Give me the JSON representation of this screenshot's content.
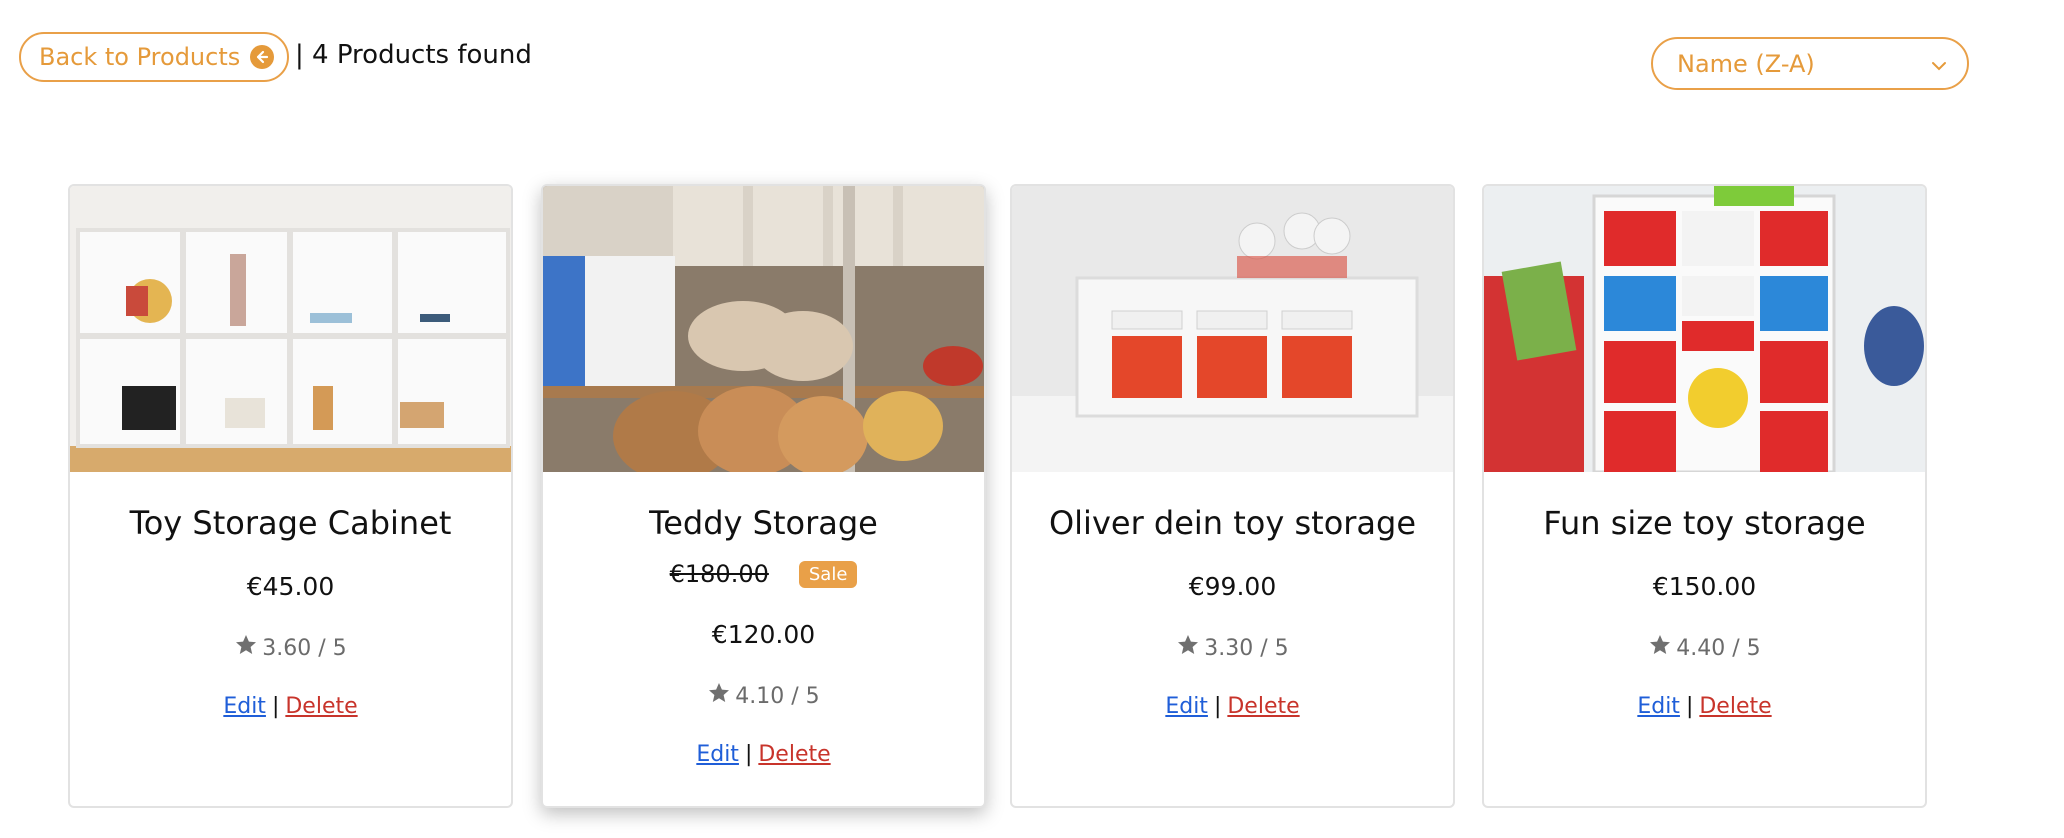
{
  "header": {
    "back_label": "Back to Products",
    "found_text": "| 4 Products found",
    "sort_value": "Name (Z-A)"
  },
  "products": [
    {
      "name": "Toy Storage Cabinet",
      "price": "€45.00",
      "rating": "3.60 / 5",
      "edit": "Edit",
      "delete": "Delete"
    },
    {
      "name": "Teddy Storage",
      "old_price": "€180.00",
      "badge": "Sale",
      "price": "€120.00",
      "rating": "4.10 / 5",
      "edit": "Edit",
      "delete": "Delete"
    },
    {
      "name": "Oliver dein toy storage",
      "price": "€99.00",
      "rating": "3.30 / 5",
      "edit": "Edit",
      "delete": "Delete"
    },
    {
      "name": "Fun size toy storage",
      "price": "€150.00",
      "rating": "4.40 / 5",
      "edit": "Edit",
      "delete": "Delete"
    }
  ],
  "colors": {
    "accent": "#e9a048",
    "link": "#1f5ed8",
    "danger": "#c8342b"
  },
  "icons": {
    "back": "arrow-left-circle-icon",
    "sort": "chevron-down-icon",
    "rating": "star-icon"
  }
}
